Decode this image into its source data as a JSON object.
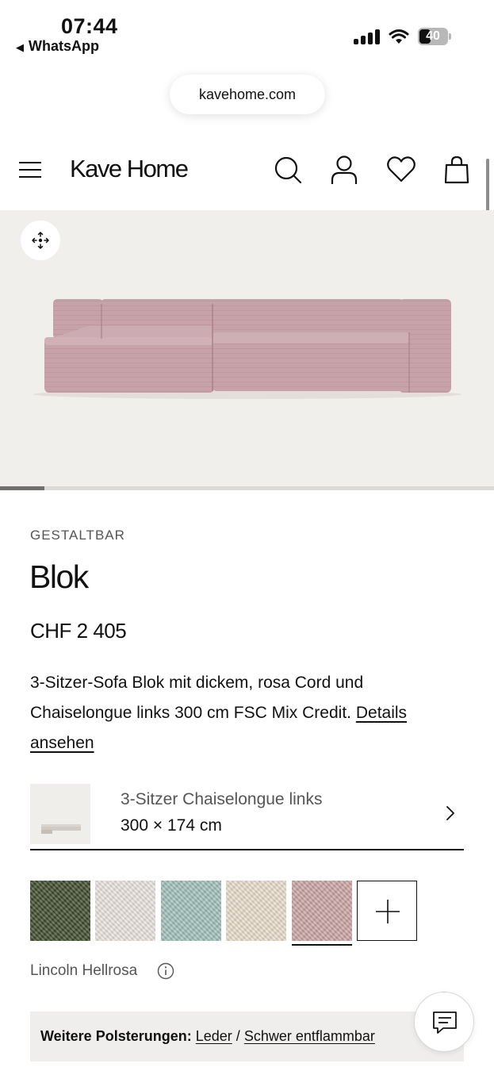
{
  "status_bar": {
    "time": "07:44",
    "back_app": "WhatsApp",
    "battery": "40"
  },
  "browser": {
    "url": "kavehome.com"
  },
  "header": {
    "logo": "Kave Home",
    "icons": [
      "menu-icon",
      "search-icon",
      "account-icon",
      "heart-icon",
      "bag-icon"
    ]
  },
  "gallery": {
    "progress": 0.09
  },
  "product": {
    "eyebrow": "GESTALTBAR",
    "name": "Blok",
    "price": "CHF 2 405",
    "description": "3-Sitzer-Sofa Blok mit dickem, rosa Cord und Chaiselongue links 300 cm FSC Mix Credit.",
    "details_link": "Details ansehen"
  },
  "configuration": {
    "name": "3-Sitzer Chaiselongue links",
    "size": "300 × 174 cm"
  },
  "fabrics": {
    "swatches": [
      {
        "name": "green-boucle",
        "color": "#3d4a2a"
      },
      {
        "name": "white-weave",
        "color": "#e9e3de"
      },
      {
        "name": "mint-boucle",
        "color": "#9fbfb8"
      },
      {
        "name": "cream-weave",
        "color": "#e8dccb"
      },
      {
        "name": "light-pink-boucle",
        "color": "#c9a4a3"
      }
    ],
    "selected_index": 4,
    "selected_label": "Lincoln Hellrosa"
  },
  "more_upholstery": {
    "label": "Weitere Polsterungen:",
    "link1": "Leder",
    "separator": "/",
    "link2": "Schwer entflammbar"
  },
  "colors": {
    "sofa": "#c9a5ab",
    "sofa_dark": "#b8929a",
    "hero_bg": "#f1efec"
  }
}
